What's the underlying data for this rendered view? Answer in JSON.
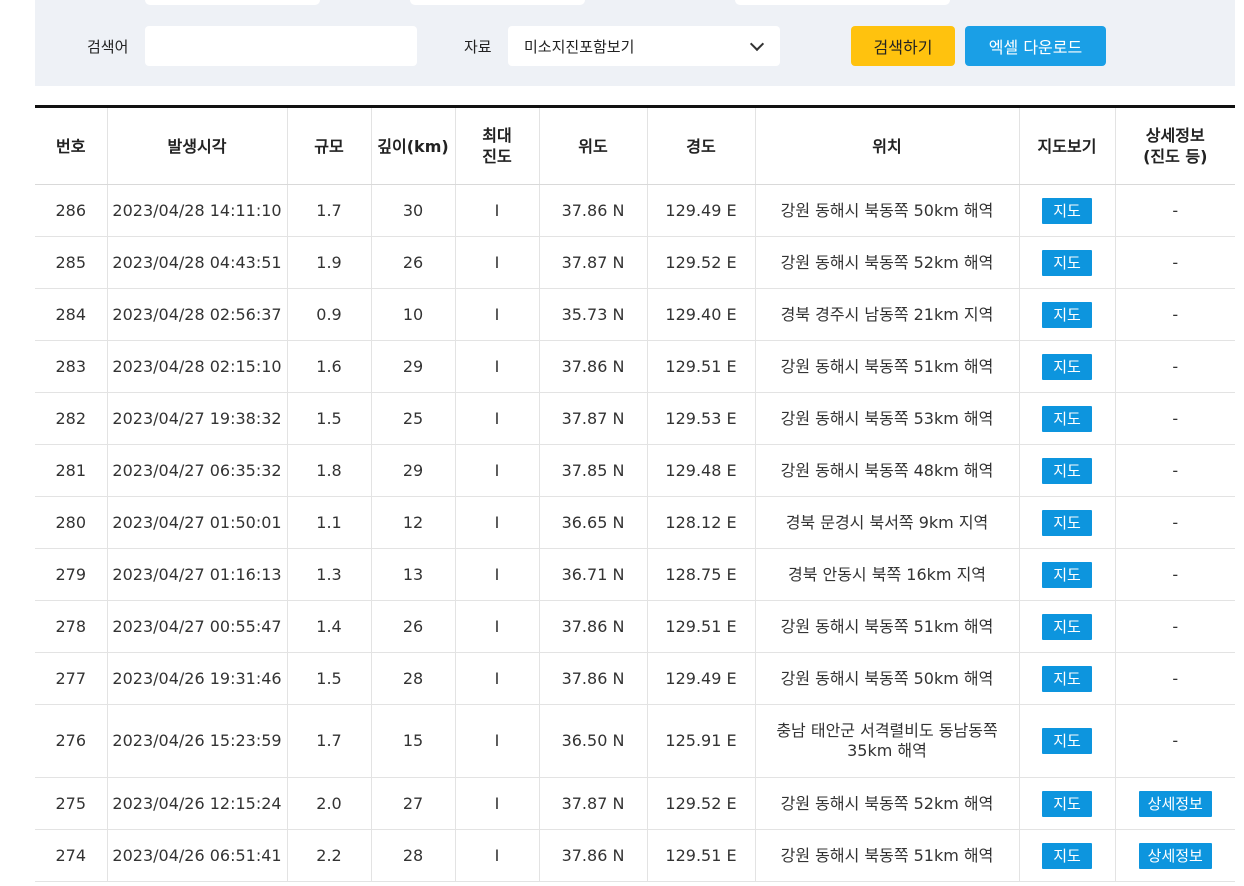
{
  "search": {
    "keyword_label": "검색어",
    "keyword_value": "",
    "source_label": "자료",
    "source_selected": "미소지진포함보기",
    "search_button": "검색하기",
    "excel_button": "엑셀 다운로드"
  },
  "table": {
    "headers": {
      "no": "번호",
      "time": "발생시각",
      "mag": "규모",
      "depth": "깊이(km)",
      "intensity_1": "최대",
      "intensity_2": "진도",
      "lat": "위도",
      "lon": "경도",
      "loc": "위치",
      "map": "지도보기",
      "detail_1": "상세정보",
      "detail_2": "(진도 등)"
    },
    "rows": [
      {
        "no": "286",
        "time": "2023/04/28 14:11:10",
        "mag": "1.7",
        "depth": "30",
        "intensity": "I",
        "lat": "37.86 N",
        "lon": "129.49 E",
        "loc": "강원 동해시 북동쪽 50km 해역",
        "map": "지도",
        "detail": "-"
      },
      {
        "no": "285",
        "time": "2023/04/28 04:43:51",
        "mag": "1.9",
        "depth": "26",
        "intensity": "I",
        "lat": "37.87 N",
        "lon": "129.52 E",
        "loc": "강원 동해시 북동쪽 52km 해역",
        "map": "지도",
        "detail": "-"
      },
      {
        "no": "284",
        "time": "2023/04/28 02:56:37",
        "mag": "0.9",
        "depth": "10",
        "intensity": "I",
        "lat": "35.73 N",
        "lon": "129.40 E",
        "loc": "경북 경주시 남동쪽 21km 지역",
        "map": "지도",
        "detail": "-"
      },
      {
        "no": "283",
        "time": "2023/04/28 02:15:10",
        "mag": "1.6",
        "depth": "29",
        "intensity": "I",
        "lat": "37.86 N",
        "lon": "129.51 E",
        "loc": "강원 동해시 북동쪽 51km 해역",
        "map": "지도",
        "detail": "-"
      },
      {
        "no": "282",
        "time": "2023/04/27 19:38:32",
        "mag": "1.5",
        "depth": "25",
        "intensity": "I",
        "lat": "37.87 N",
        "lon": "129.53 E",
        "loc": "강원 동해시 북동쪽 53km 해역",
        "map": "지도",
        "detail": "-"
      },
      {
        "no": "281",
        "time": "2023/04/27 06:35:32",
        "mag": "1.8",
        "depth": "29",
        "intensity": "I",
        "lat": "37.85 N",
        "lon": "129.48 E",
        "loc": "강원 동해시 북동쪽 48km 해역",
        "map": "지도",
        "detail": "-"
      },
      {
        "no": "280",
        "time": "2023/04/27 01:50:01",
        "mag": "1.1",
        "depth": "12",
        "intensity": "I",
        "lat": "36.65 N",
        "lon": "128.12 E",
        "loc": "경북 문경시 북서쪽 9km 지역",
        "map": "지도",
        "detail": "-"
      },
      {
        "no": "279",
        "time": "2023/04/27 01:16:13",
        "mag": "1.3",
        "depth": "13",
        "intensity": "I",
        "lat": "36.71 N",
        "lon": "128.75 E",
        "loc": "경북 안동시 북쪽 16km 지역",
        "map": "지도",
        "detail": "-"
      },
      {
        "no": "278",
        "time": "2023/04/27 00:55:47",
        "mag": "1.4",
        "depth": "26",
        "intensity": "I",
        "lat": "37.86 N",
        "lon": "129.51 E",
        "loc": "강원 동해시 북동쪽 51km 해역",
        "map": "지도",
        "detail": "-"
      },
      {
        "no": "277",
        "time": "2023/04/26 19:31:46",
        "mag": "1.5",
        "depth": "28",
        "intensity": "I",
        "lat": "37.86 N",
        "lon": "129.49 E",
        "loc": "강원 동해시 북동쪽 50km 해역",
        "map": "지도",
        "detail": "-"
      },
      {
        "no": "276",
        "time": "2023/04/26 15:23:59",
        "mag": "1.7",
        "depth": "15",
        "intensity": "I",
        "lat": "36.50 N",
        "lon": "125.91 E",
        "loc": "충남 태안군 서격렬비도 동남동쪽 35km 해역",
        "map": "지도",
        "detail": "-"
      },
      {
        "no": "275",
        "time": "2023/04/26 12:15:24",
        "mag": "2.0",
        "depth": "27",
        "intensity": "I",
        "lat": "37.87 N",
        "lon": "129.52 E",
        "loc": "강원 동해시 북동쪽 52km 해역",
        "map": "지도",
        "detail": "상세정보"
      },
      {
        "no": "274",
        "time": "2023/04/26 06:51:41",
        "mag": "2.2",
        "depth": "28",
        "intensity": "I",
        "lat": "37.86 N",
        "lon": "129.51 E",
        "loc": "강원 동해시 북동쪽 51km 해역",
        "map": "지도",
        "detail": "상세정보"
      }
    ]
  }
}
